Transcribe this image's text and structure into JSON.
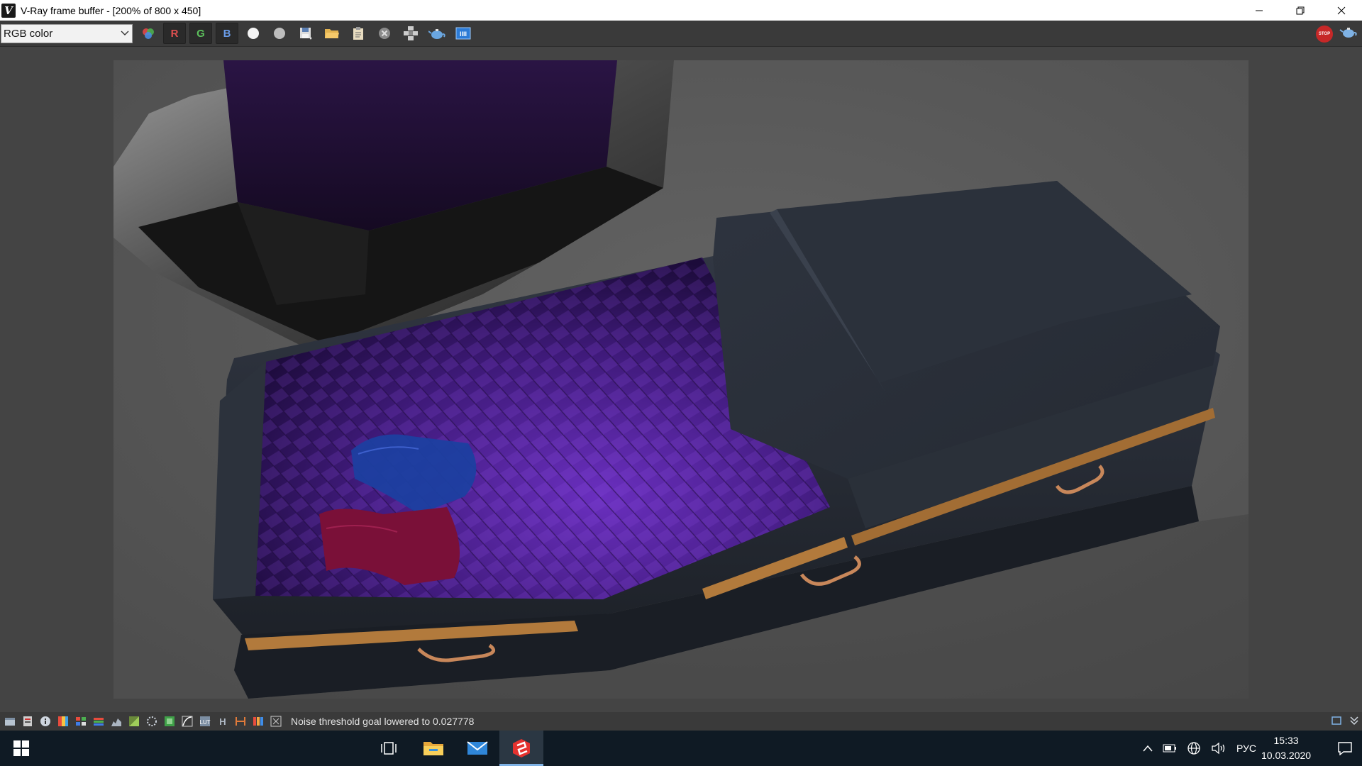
{
  "window": {
    "title": "V-Ray frame buffer - [200% of 800 x 450]",
    "app_icon": "vray-icon",
    "controls": [
      "minimize-icon",
      "restore-icon",
      "close-icon"
    ]
  },
  "toolbar": {
    "channel_value": "RGB color",
    "channel_r": "R",
    "channel_g": "G",
    "channel_b": "B",
    "left_icons": [
      "rgb-channels-icon",
      "red-channel-button",
      "green-channel-button",
      "blue-channel-button",
      "white-circle-icon",
      "gray-circle-icon",
      "save-icon",
      "open-folder-icon",
      "clipboard-icon",
      "clear-icon",
      "region-render-icon",
      "teapot-render-icon",
      "lens-effects-icon"
    ],
    "right_icons": [
      "stop-icon",
      "teapot-icon"
    ],
    "stop_label": "STOP"
  },
  "statusbar": {
    "message": "Noise threshold goal lowered to 0.027778",
    "icons": [
      "history-icon",
      "levels-icon",
      "info-icon",
      "color-correction-icon",
      "lut-icon",
      "histogram-icon",
      "curves-icon",
      "exposure-icon",
      "white-balance-icon",
      "hsv-icon",
      "color-balance-icon",
      "background-icon",
      "bloom-icon",
      "lens-icon",
      "h-icon",
      "compare-icon",
      "stereo-icon",
      "checker-icon"
    ],
    "right_icons": [
      "fullscreen-icon",
      "expand-icon"
    ]
  },
  "taskbar": {
    "apps": [
      "start-icon",
      "task-view-icon",
      "file-explorer-icon",
      "mail-icon",
      "sketchup-icon"
    ],
    "active_app": "sketchup-icon",
    "language": "РУС",
    "time": "15:33",
    "date": "10.03.2020"
  },
  "colors": {
    "accent": "#7fb2e5",
    "viewport_bg": "#444444",
    "stop_red": "#c62828",
    "lining_purple": "#4b1c8c",
    "coffin_wood": "#2a2f38",
    "trim_gold": "#b27a3c"
  }
}
